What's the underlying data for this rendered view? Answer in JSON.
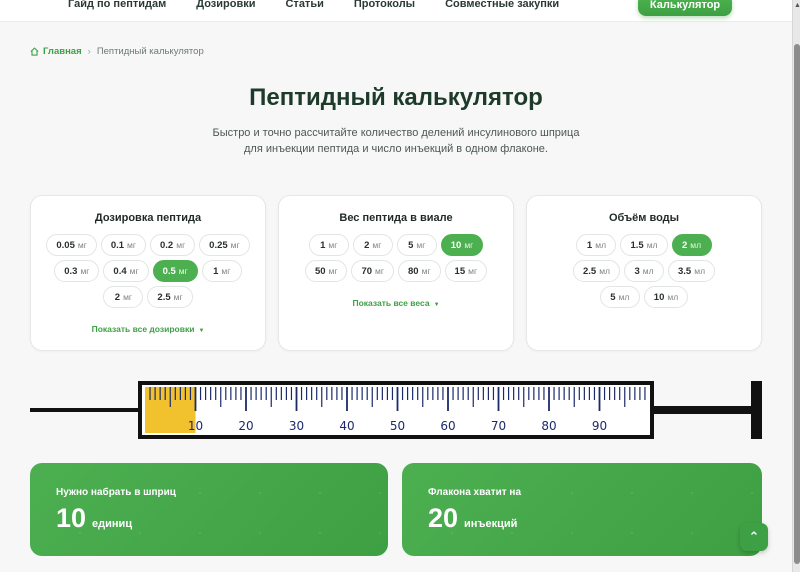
{
  "nav": {
    "links": [
      "Гайд по пептидам",
      "Дозировки",
      "Статьи",
      "Протоколы",
      "Совместные закупки"
    ],
    "calc_button": "Калькулятор"
  },
  "breadcrumb": {
    "home": "Главная",
    "separator": "›",
    "current": "Пептидный калькулятор"
  },
  "page": {
    "title": "Пептидный калькулятор",
    "subtitle_line1": "Быстро и точно рассчитайте количество делений инсулинового шприца",
    "subtitle_line2": "для инъекции пептида и число инъекций в одном флаконе."
  },
  "dose": {
    "title": "Дозировка пептида",
    "options": [
      {
        "v": "0.05",
        "u": "мг"
      },
      {
        "v": "0.1",
        "u": "мг"
      },
      {
        "v": "0.2",
        "u": "мг"
      },
      {
        "v": "0.25",
        "u": "мг"
      },
      {
        "v": "0.3",
        "u": "мг"
      },
      {
        "v": "0.4",
        "u": "мг"
      },
      {
        "v": "0.5",
        "u": "мг"
      },
      {
        "v": "1",
        "u": "мг"
      },
      {
        "v": "2",
        "u": "мг"
      },
      {
        "v": "2.5",
        "u": "мг"
      }
    ],
    "selected": 6,
    "show_all": "Показать все дозировки"
  },
  "vial": {
    "title": "Вес пептида в виале",
    "options": [
      {
        "v": "1",
        "u": "мг"
      },
      {
        "v": "2",
        "u": "мг"
      },
      {
        "v": "5",
        "u": "мг"
      },
      {
        "v": "10",
        "u": "мг"
      },
      {
        "v": "50",
        "u": "мг"
      },
      {
        "v": "70",
        "u": "мг"
      },
      {
        "v": "80",
        "u": "мг"
      },
      {
        "v": "15",
        "u": "мг"
      }
    ],
    "selected": 3,
    "show_all": "Показать все веса"
  },
  "water": {
    "title": "Объём воды",
    "options": [
      {
        "v": "1",
        "u": "мл"
      },
      {
        "v": "1.5",
        "u": "мл"
      },
      {
        "v": "2",
        "u": "мл"
      },
      {
        "v": "2.5",
        "u": "мл"
      },
      {
        "v": "3",
        "u": "мл"
      },
      {
        "v": "3.5",
        "u": "мл"
      },
      {
        "v": "5",
        "u": "мл"
      },
      {
        "v": "10",
        "u": "мл"
      }
    ],
    "selected": 2
  },
  "syringe": {
    "fill_units": 10,
    "max_units": 100,
    "labels": [
      "10",
      "20",
      "30",
      "40",
      "50",
      "60",
      "70",
      "80",
      "90"
    ],
    "fill_color": "#f2c12e"
  },
  "results": {
    "draw_label": "Нужно набрать в шприц",
    "draw_value": "10",
    "draw_unit": "единиц",
    "vial_label": "Флакона хватит на",
    "vial_value": "20",
    "vial_unit": "инъекций"
  },
  "colors": {
    "accent": "#4caf50",
    "title": "#1e3a2b"
  }
}
